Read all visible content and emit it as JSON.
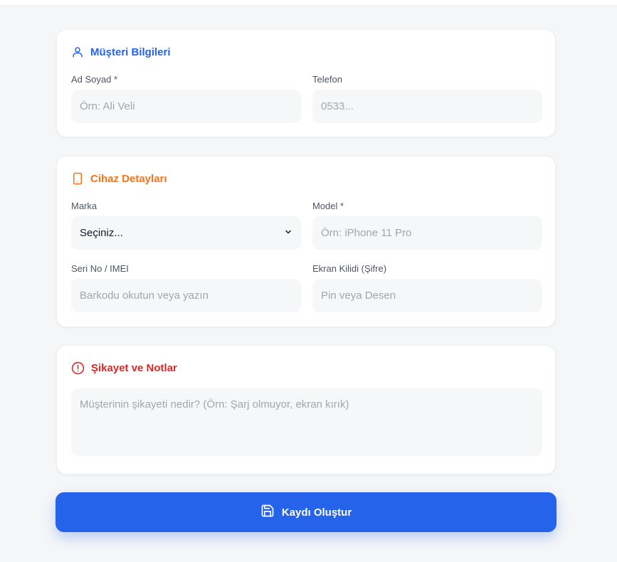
{
  "colors": {
    "customer_accent": "#2563eb",
    "device_accent": "#f97316",
    "complaint_accent": "#dc2626",
    "primary_button": "#2563eb"
  },
  "customer": {
    "title": "Müşteri Bilgileri",
    "icon": "user-icon",
    "name_label": "Ad Soyad *",
    "name_placeholder": "Örn: Ali Veli",
    "phone_label": "Telefon",
    "phone_placeholder": "0533..."
  },
  "device": {
    "title": "Cihaz Detayları",
    "icon": "smartphone-icon",
    "brand_label": "Marka",
    "brand_selected": "Seçiniz...",
    "model_label": "Model *",
    "model_placeholder": "Örn: iPhone 11 Pro",
    "serial_label": "Seri No / IMEI",
    "serial_placeholder": "Barkodu okutun veya yazın",
    "lock_label": "Ekran Kilidi (Şifre)",
    "lock_placeholder": "Pin veya Desen"
  },
  "complaint": {
    "title": "Şikayet ve Notlar",
    "icon": "alert-circle-icon",
    "placeholder": "Müşterinin şikayeti nedir? (Örn: Şarj olmuyor, ekran kırık)"
  },
  "submit": {
    "label": "Kaydı Oluştur",
    "icon": "save-icon"
  }
}
